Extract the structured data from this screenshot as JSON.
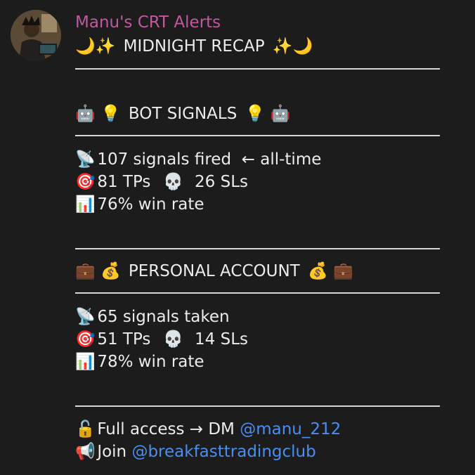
{
  "message": {
    "sender": "Manu's CRT Alerts",
    "title": {
      "left_icons": "🌙✨",
      "text": "MIDNIGHT RECAP",
      "right_icons": "✨🌙"
    }
  },
  "bot_section": {
    "header_left": "🤖 💡",
    "header": "BOT SIGNALS",
    "header_right": "💡 🤖",
    "signals": {
      "icon": "📡",
      "text": "107 signals fired  ← all-time"
    },
    "results": {
      "tp_icon": "🎯",
      "tps": "81 TPs",
      "sl_icon": "💀",
      "sls": "26 SLs"
    },
    "winrate": {
      "icon": "📊",
      "text": "76% win rate"
    }
  },
  "personal_section": {
    "header_left": "💼 💰",
    "header": "PERSONAL ACCOUNT",
    "header_right": "💰 💼",
    "signals": {
      "icon": "📡",
      "text": "65 signals taken"
    },
    "results": {
      "tp_icon": "🎯",
      "tps": "51 TPs",
      "sl_icon": "💀",
      "sls": "14 SLs"
    },
    "winrate": {
      "icon": "📊",
      "text": "78% win rate"
    }
  },
  "footer": {
    "access": {
      "icon": "🔓",
      "text": "Full access → DM ",
      "link": "@manu_212"
    },
    "join": {
      "icon": "📢",
      "text": "Join ",
      "link": "@breakfasttradingclub"
    }
  },
  "colors": {
    "background": "#1c1c1d",
    "sender": "#c1599c",
    "link": "#4b8ef0",
    "text": "#ececec"
  }
}
